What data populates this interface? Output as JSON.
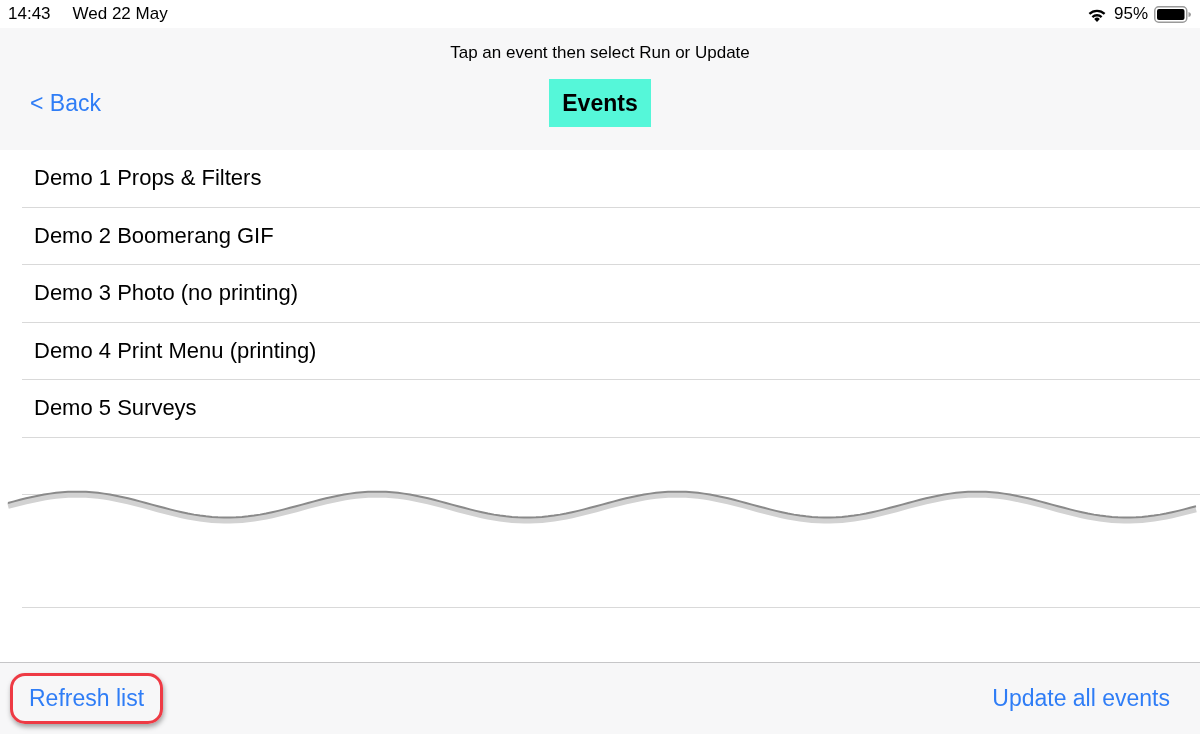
{
  "status_bar": {
    "time": "14:43",
    "date": "Wed 22 May",
    "battery_percent": "95%"
  },
  "nav_bar": {
    "hint": "Tap an event then select Run or Update",
    "back_button": "< Back",
    "title": "Events",
    "title_highlighted": true
  },
  "events": [
    {
      "name": "Demo 1 Props & Filters",
      "selected": false
    },
    {
      "name": "Demo 2 Boomerang GIF",
      "selected": false
    },
    {
      "name": "Demo 3 Photo (no printing)",
      "selected": false
    },
    {
      "name": "Demo 4 Print Menu (printing)",
      "selected": false
    },
    {
      "name": "Demo 5 Surveys",
      "selected": false
    }
  ],
  "toolbar": {
    "buttons": [
      {
        "label": "Refresh list",
        "highlighted": true
      },
      {
        "label": "Update all events",
        "highlighted": false
      }
    ]
  }
}
